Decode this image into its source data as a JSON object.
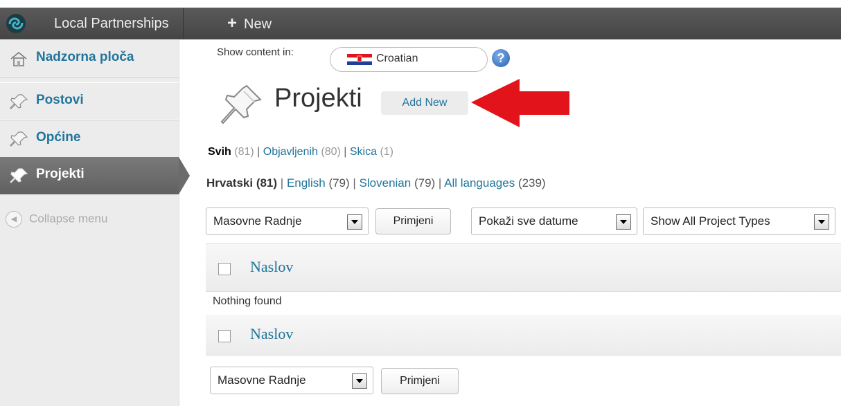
{
  "adminbar": {
    "site_name": "Local Partnerships",
    "new_label": "New"
  },
  "sidebar": {
    "items": [
      {
        "label": "Nadzorna ploča",
        "icon": "home-icon"
      },
      {
        "label": "Postovi",
        "icon": "pushpin-icon"
      },
      {
        "label": "Općine",
        "icon": "pushpin-icon"
      },
      {
        "label": "Projekti",
        "icon": "pushpin-icon",
        "current": true
      }
    ],
    "collapse_label": "Collapse menu"
  },
  "content_lang": {
    "label": "Show content in:",
    "selected": "Croatian",
    "flag": "croatia-flag-icon"
  },
  "page": {
    "title": "Projekti",
    "add_new": "Add New"
  },
  "status_links": {
    "all": "Svih",
    "all_count": "(81)",
    "published": "Objavljenih",
    "published_count": "(80)",
    "draft": "Skica",
    "draft_count": "(1)"
  },
  "language_links": {
    "current": "Hrvatski (81)",
    "english": "English",
    "english_count": "(79)",
    "slovenian": "Slovenian",
    "slovenian_count": "(79)",
    "all": "All languages",
    "all_count": "(239)"
  },
  "filters": {
    "bulk_action": "Masovne Radnje",
    "apply": "Primjeni",
    "dates": "Pokaži sve datume",
    "types": "Show All Project Types"
  },
  "table": {
    "column_title": "Naslov",
    "empty_message": "Nothing found"
  },
  "colors": {
    "link": "#21759b",
    "adminbar": "#464646",
    "annotation_arrow": "#e3131c"
  }
}
